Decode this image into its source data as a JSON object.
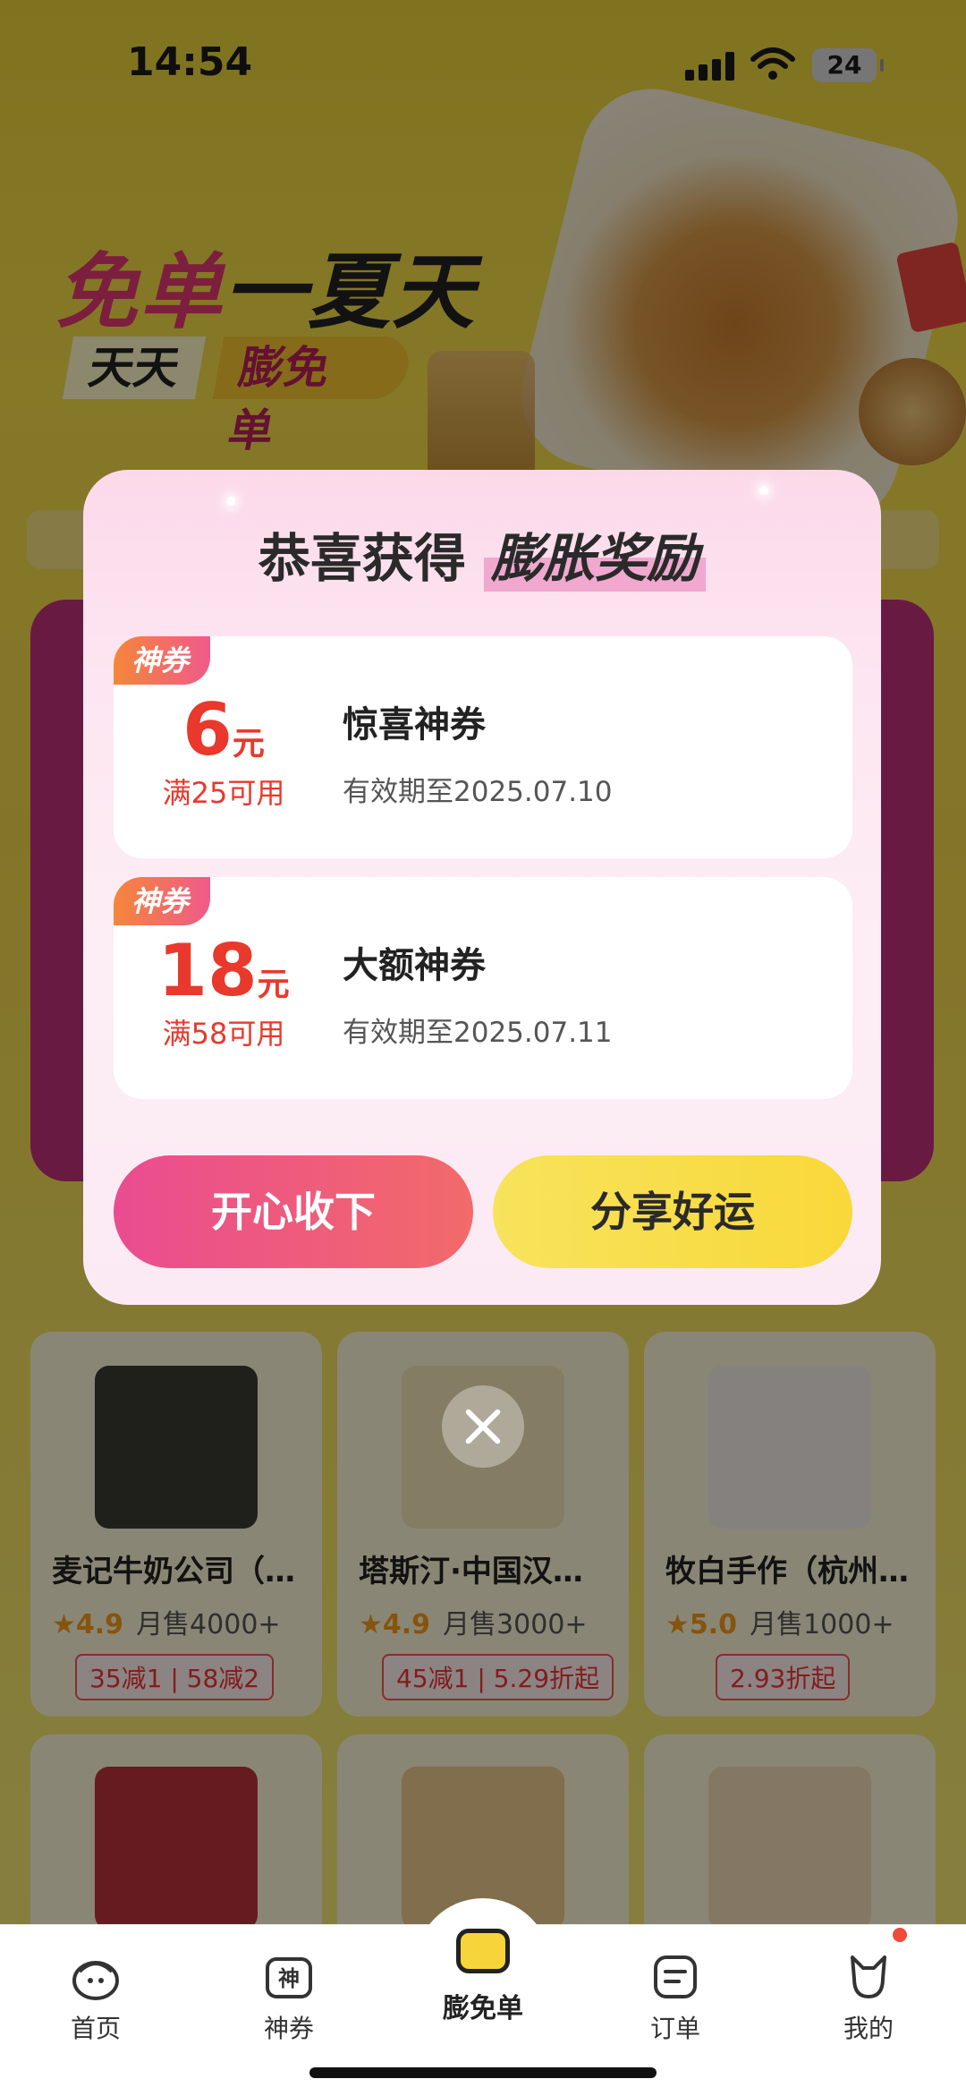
{
  "status_bar": {
    "time": "14:54",
    "battery": "24"
  },
  "banner": {
    "title_pink": "免单",
    "title_dark": "一夏天",
    "tag_left": "天天",
    "tag_right": "膨免单"
  },
  "stores_row1": [
    {
      "name": "麦记牛奶公司（…",
      "rating": "4.9",
      "sales": "月售4000+",
      "promo": "35减1 | 58减2",
      "img_color": "#3a3a32"
    },
    {
      "name": "塔斯汀·中国汉…",
      "rating": "4.9",
      "sales": "月售3000+",
      "promo": "45减1 | 5.29折起",
      "img_color": "#f3e2b6"
    },
    {
      "name": "牧白手作（杭州…",
      "rating": "5.0",
      "sales": "月售1000+",
      "promo": "2.93折起",
      "img_color": "#f1ece6"
    }
  ],
  "stores_row2_colors": [
    "#b8323a",
    "#e9c98a",
    "#f1d9b4"
  ],
  "modal": {
    "title_prefix": "恭喜获得",
    "title_highlight": "膨胀奖励",
    "coupons": [
      {
        "tag": "神券",
        "amount": "6",
        "unit": "元",
        "condition": "满25可用",
        "title": "惊喜神券",
        "validity": "有效期至2025.07.10"
      },
      {
        "tag": "神券",
        "amount": "18",
        "unit": "元",
        "condition": "满58可用",
        "title": "大额神券",
        "validity": "有效期至2025.07.11"
      }
    ],
    "accept_label": "开心收下",
    "share_label": "分享好运"
  },
  "tabbar": {
    "home": "首页",
    "coupons": "神券",
    "center": "膨免单",
    "orders": "订单",
    "mine": "我的"
  },
  "colors": {
    "accent_pink": "#ea4c90",
    "accent_yellow": "#f7d53a",
    "price_red": "#e8392c"
  }
}
